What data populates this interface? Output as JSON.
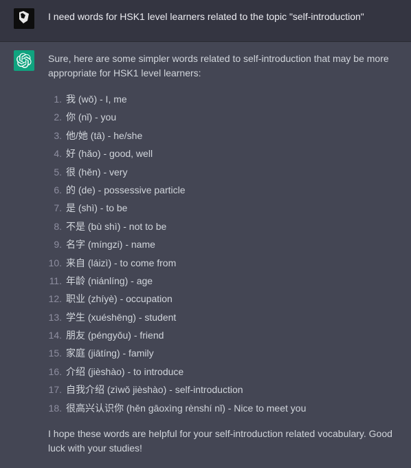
{
  "user_message": "I need words for HSK1 level learners related to the topic \"self-introduction\"",
  "assistant": {
    "intro": "Sure, here are some simpler words related to self-introduction that may be more appropriate for HSK1 level learners:",
    "items": [
      "我 (wǒ) - I, me",
      "你 (nǐ) - you",
      "他/她 (tā) - he/she",
      "好 (hǎo) - good, well",
      "很 (hěn) - very",
      "的 (de) - possessive particle",
      "是 (shì) - to be",
      "不是 (bù shì) - not to be",
      "名字 (míngzi) - name",
      "来自 (láizì) - to come from",
      "年龄 (niánlíng) - age",
      "职业 (zhíyè) - occupation",
      "学生 (xuéshēng) - student",
      "朋友 (péngyǒu) - friend",
      "家庭 (jiātíng) - family",
      "介绍 (jièshào) - to introduce",
      "自我介绍 (zìwǒ jièshào) - self-introduction",
      "很高兴认识你 (hěn gāoxìng rènshí nǐ) - Nice to meet you"
    ],
    "outro": "I hope these words are helpful for your self-introduction related vocabulary. Good luck with your studies!"
  }
}
